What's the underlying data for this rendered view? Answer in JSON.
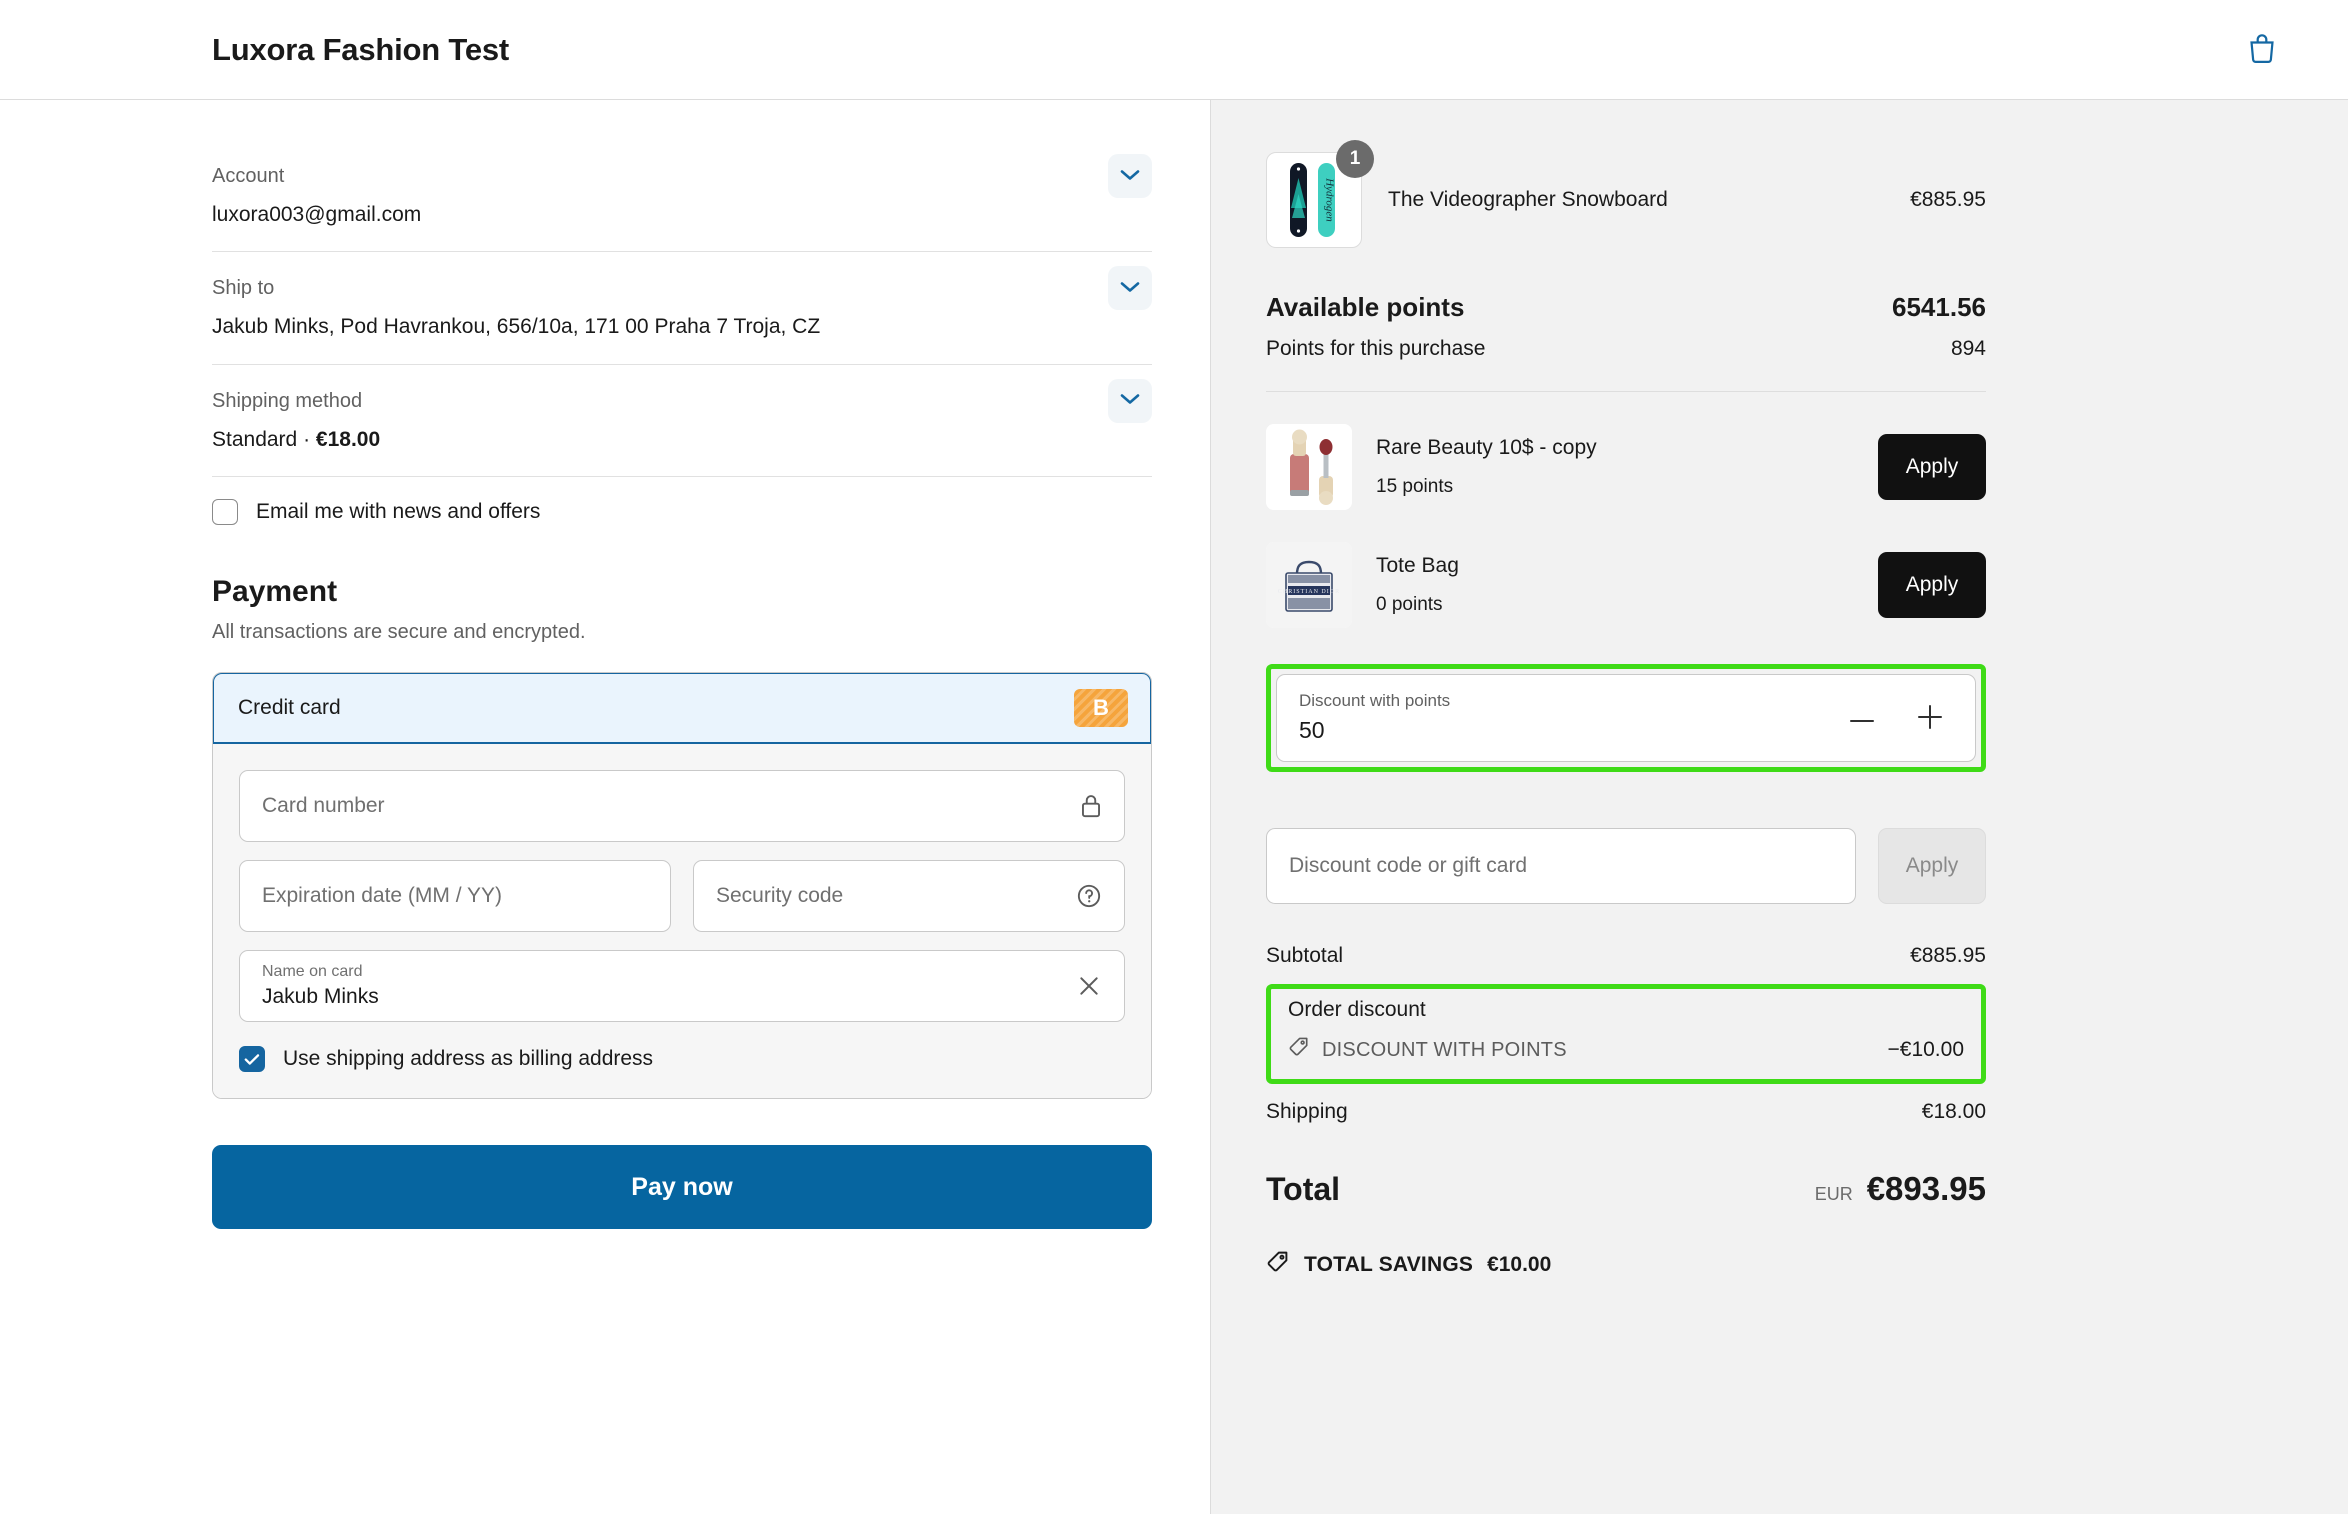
{
  "header": {
    "shop_title": "Luxora Fashion Test",
    "bag_icon": "shopping-bag-icon",
    "accent_blue": "#1565a0"
  },
  "review": {
    "account": {
      "label": "Account",
      "value": "luxora003@gmail.com"
    },
    "ship_to": {
      "label": "Ship to",
      "value": "Jakub Minks, Pod Havrankou, 656/10a, 171 00 Praha 7 Troja, CZ"
    },
    "shipping_method": {
      "label": "Shipping method",
      "value_name": "Standard · ",
      "value_price": "€18.00"
    },
    "change_icon": "chevron-down-icon"
  },
  "email_optin": {
    "label": "Email me with news and offers",
    "checked": false
  },
  "payment": {
    "title": "Payment",
    "subtitle": "All transactions are secure and encrypted.",
    "method_label": "Credit card",
    "gateway_badge": "B",
    "gateway_badge_color": "#f5a43c",
    "card_number": {
      "placeholder": "Card number",
      "value": "",
      "icon": "lock-icon"
    },
    "expiration": {
      "placeholder": "Expiration date (MM / YY)",
      "value": ""
    },
    "security_code": {
      "placeholder": "Security code",
      "value": "",
      "icon": "question-circle-icon"
    },
    "name_on_card": {
      "label": "Name on card",
      "value": "Jakub Minks",
      "icon": "clear-x-icon"
    },
    "billing_same": {
      "label": "Use shipping address as billing address",
      "checked": true
    },
    "pay_button": "Pay now",
    "pay_button_color": "#0665a0"
  },
  "summary": {
    "line_items": [
      {
        "name": "The Videographer Snowboard",
        "price": "€885.95",
        "qty": "1",
        "thumb": "snowboard-pair-image"
      }
    ],
    "points": {
      "available_label": "Available points",
      "available_value": "6541.56",
      "purchase_label": "Points for this purchase",
      "purchase_value": "894"
    },
    "rewards": [
      {
        "name": "Rare Beauty 10$ - copy",
        "points": "15 points",
        "button": "Apply",
        "thumb": "lipgloss-image"
      },
      {
        "name": "Tote Bag",
        "points": "0 points",
        "button": "Apply",
        "thumb": "tote-bag-image"
      }
    ],
    "points_stepper": {
      "label": "Discount with points",
      "value": "50",
      "decrement_icon": "minus-icon",
      "increment_icon": "plus-icon",
      "highlight_color": "#3fdb17"
    },
    "discount_code": {
      "placeholder": "Discount code or gift card",
      "value": "",
      "button": "Apply"
    },
    "subtotal": {
      "label": "Subtotal",
      "value": "€885.95"
    },
    "order_discount": {
      "label": "Order discount",
      "code": "DISCOUNT WITH POINTS",
      "amount": "−€10.00",
      "tag_icon": "discount-tag-icon",
      "highlight_color": "#3fdb17"
    },
    "shipping": {
      "label": "Shipping",
      "value": "€18.00"
    },
    "total": {
      "label": "Total",
      "currency": "EUR",
      "value": "€893.95"
    },
    "total_savings": {
      "label": "TOTAL SAVINGS",
      "value": "€10.00",
      "tag_icon": "savings-tag-icon"
    }
  }
}
